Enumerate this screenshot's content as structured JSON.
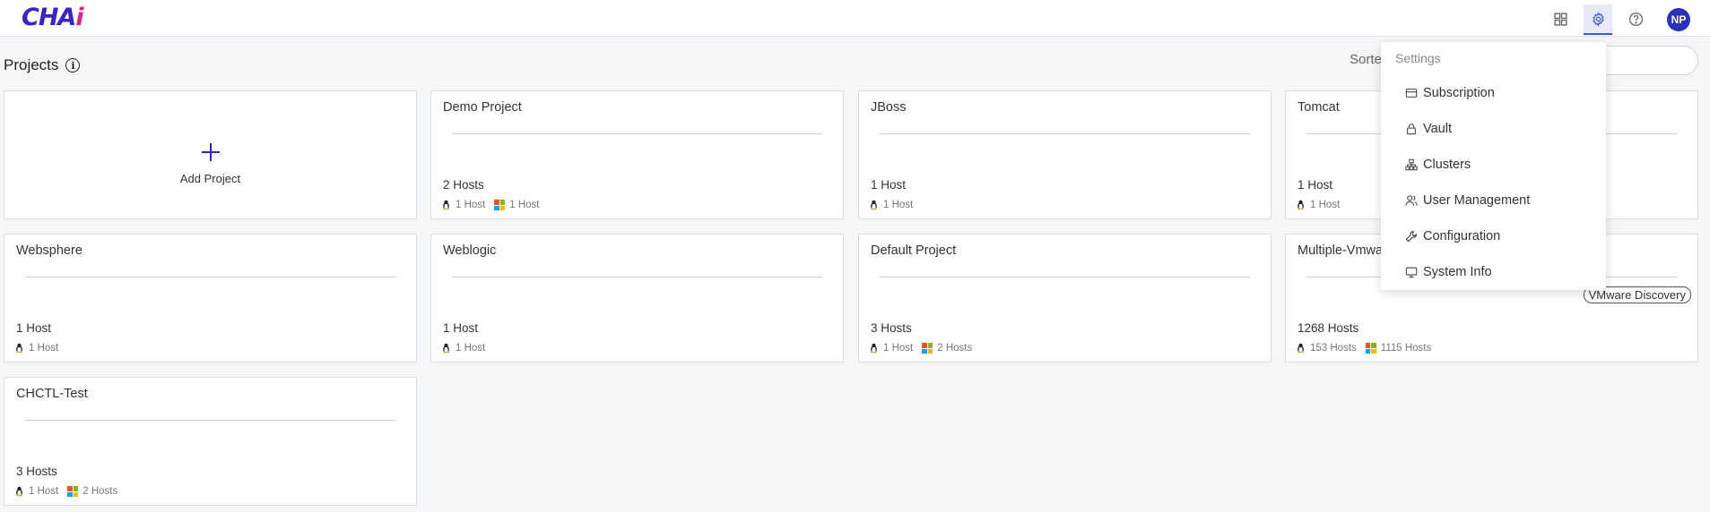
{
  "header": {
    "logo_text_a": "CHA",
    "logo_text_b": "i",
    "icons": [
      "apps-grid-icon",
      "gear-icon",
      "help-icon"
    ],
    "avatar_initials": "NP",
    "accent_color": "#3a24c9"
  },
  "page": {
    "title": "Projects",
    "info_icon": "i",
    "sort_label": "Sorte"
  },
  "add_project": {
    "label": "Add Project"
  },
  "projects": [
    {
      "name": "Demo Project",
      "hosts": "2 Hosts",
      "linux": "1 Host",
      "windows": "1 Host"
    },
    {
      "name": "JBoss",
      "hosts": "1 Host",
      "linux": "1 Host"
    },
    {
      "name": "Tomcat",
      "hosts": "1 Host",
      "linux": "1 Host"
    },
    {
      "name": "Websphere",
      "hosts": "1 Host",
      "linux": "1 Host"
    },
    {
      "name": "Weblogic",
      "hosts": "1 Host",
      "linux": "1 Host"
    },
    {
      "name": "Default Project",
      "hosts": "3 Hosts",
      "linux": "1 Host",
      "windows": "2 Hosts"
    },
    {
      "name": "Multiple-Vmwa",
      "hosts": "1268 Hosts",
      "linux": "153 Hosts",
      "windows": "1115 Hosts",
      "badge": "VMware Discovery"
    },
    {
      "name": "CHCTL-Test",
      "hosts": "3 Hosts",
      "linux": "1 Host",
      "windows": "2 Hosts"
    }
  ],
  "settings_menu": {
    "heading": "Settings",
    "items": [
      {
        "label": "Subscription",
        "icon": "card-icon"
      },
      {
        "label": "Vault",
        "icon": "lock-icon"
      },
      {
        "label": "Clusters",
        "icon": "clusters-icon"
      },
      {
        "label": "User Management",
        "icon": "users-icon"
      },
      {
        "label": "Configuration",
        "icon": "wrench-icon"
      },
      {
        "label": "System Info",
        "icon": "monitor-icon"
      }
    ]
  }
}
